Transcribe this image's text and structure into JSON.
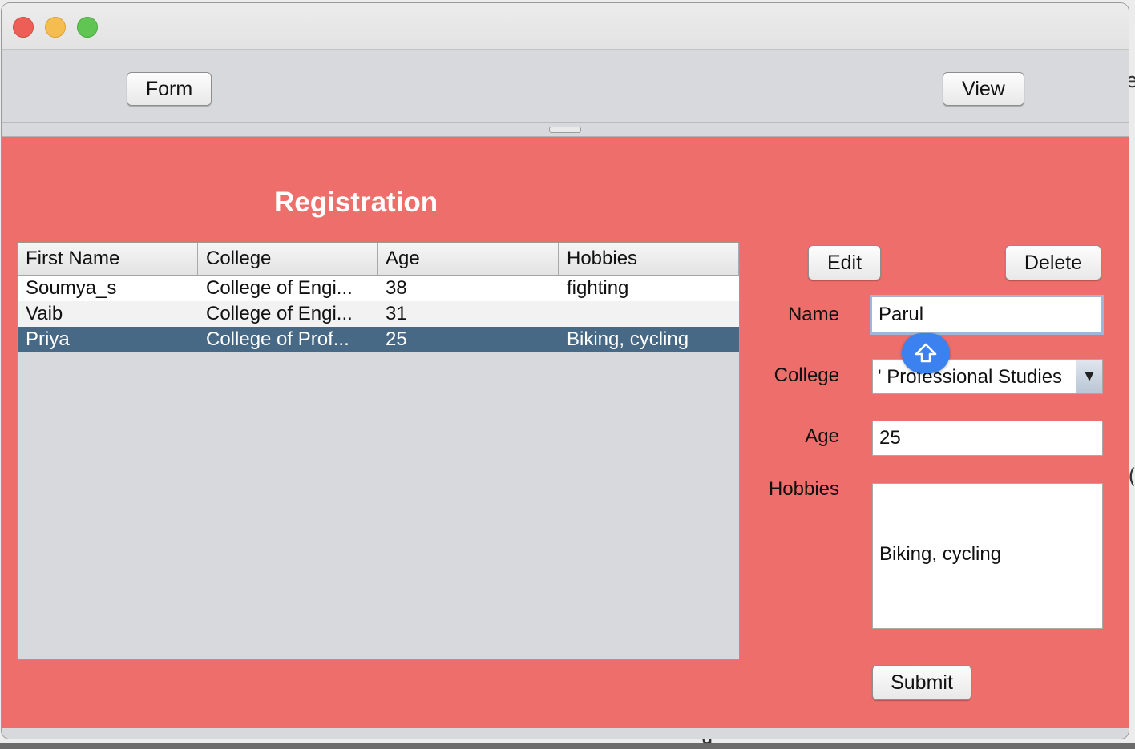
{
  "toolbar": {
    "form_label": "Form",
    "view_label": "View"
  },
  "panel": {
    "title": "Registration",
    "background": "#ed6e6a"
  },
  "table": {
    "columns": [
      "First Name",
      "College",
      "Age",
      "Hobbies"
    ],
    "rows": [
      {
        "first_name": "Soumya_s",
        "college": "College of Engi...",
        "age": "38",
        "hobbies": "fighting"
      },
      {
        "first_name": "Vaib",
        "college": "College of Engi...",
        "age": "31",
        "hobbies": ""
      },
      {
        "first_name": "Priya",
        "college": "College of Prof...",
        "age": "25",
        "hobbies": "Biking, cycling"
      }
    ],
    "selected_row": 2,
    "selection_color": "#476985"
  },
  "form": {
    "edit_label": "Edit",
    "delete_label": "Delete",
    "name_label": "Name",
    "name_value": "Parul",
    "college_label": "College",
    "college_value": "' Professional Studies",
    "age_label": "Age",
    "age_value": "25",
    "hobbies_label": "Hobbies",
    "hobbies_value": "Biking, cycling",
    "submit_label": "Submit"
  },
  "icons": {
    "keyboard_badge": "shift-arrow-icon",
    "dropdown": "chevron-down-icon"
  }
}
